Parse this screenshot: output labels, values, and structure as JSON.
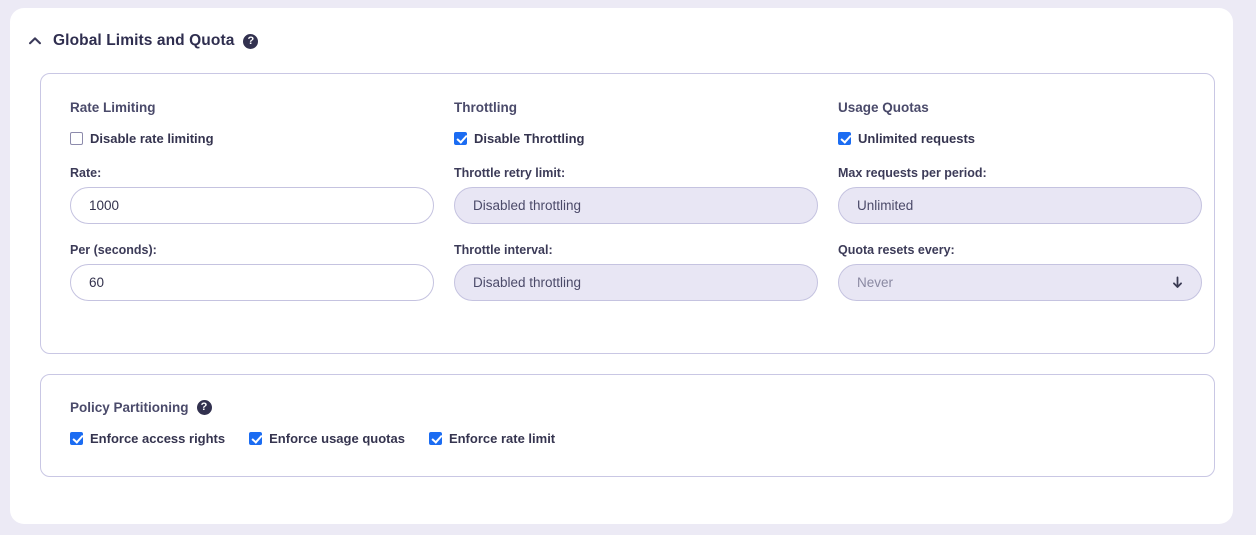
{
  "section": {
    "title": "Global Limits and Quota",
    "collapse_icon": "chevron-up-icon",
    "help_icon": "help-icon",
    "help_glyph": "?"
  },
  "rate_limiting": {
    "title": "Rate Limiting",
    "disable_checkbox": {
      "label": "Disable rate limiting",
      "checked": false
    },
    "rate": {
      "label": "Rate:",
      "value": "1000",
      "disabled": false
    },
    "per_seconds": {
      "label": "Per (seconds):",
      "value": "60",
      "disabled": false
    }
  },
  "throttling": {
    "title": "Throttling",
    "disable_checkbox": {
      "label": "Disable Throttling",
      "checked": true
    },
    "retry_limit": {
      "label": "Throttle retry limit:",
      "value": "Disabled throttling",
      "disabled": true
    },
    "interval": {
      "label": "Throttle interval:",
      "value": "Disabled throttling",
      "disabled": true
    }
  },
  "usage_quotas": {
    "title": "Usage Quotas",
    "unlimited_checkbox": {
      "label": "Unlimited requests",
      "checked": true
    },
    "max_requests": {
      "label": "Max requests per period:",
      "value": "Unlimited",
      "disabled": true
    },
    "quota_resets": {
      "label": "Quota resets every:",
      "value": "Never",
      "disabled": true,
      "icon": "arrow-down-icon"
    }
  },
  "policy_partitioning": {
    "title": "Policy Partitioning",
    "help_glyph": "?",
    "checkboxes": [
      {
        "label": "Enforce access rights",
        "checked": true
      },
      {
        "label": "Enforce usage quotas",
        "checked": true
      },
      {
        "label": "Enforce rate limit",
        "checked": true
      }
    ]
  },
  "colors": {
    "page_background": "#eceaf5",
    "card_background": "#ffffff",
    "panel_border": "#c9c7e4",
    "input_border": "#c5c3e0",
    "input_disabled_fill": "#e8e6f4",
    "checkbox_checked": "#1b6cf2",
    "title_text": "#2f2e4f",
    "label_text": "#3c3b58",
    "placeholder_text": "#8a89a2"
  }
}
